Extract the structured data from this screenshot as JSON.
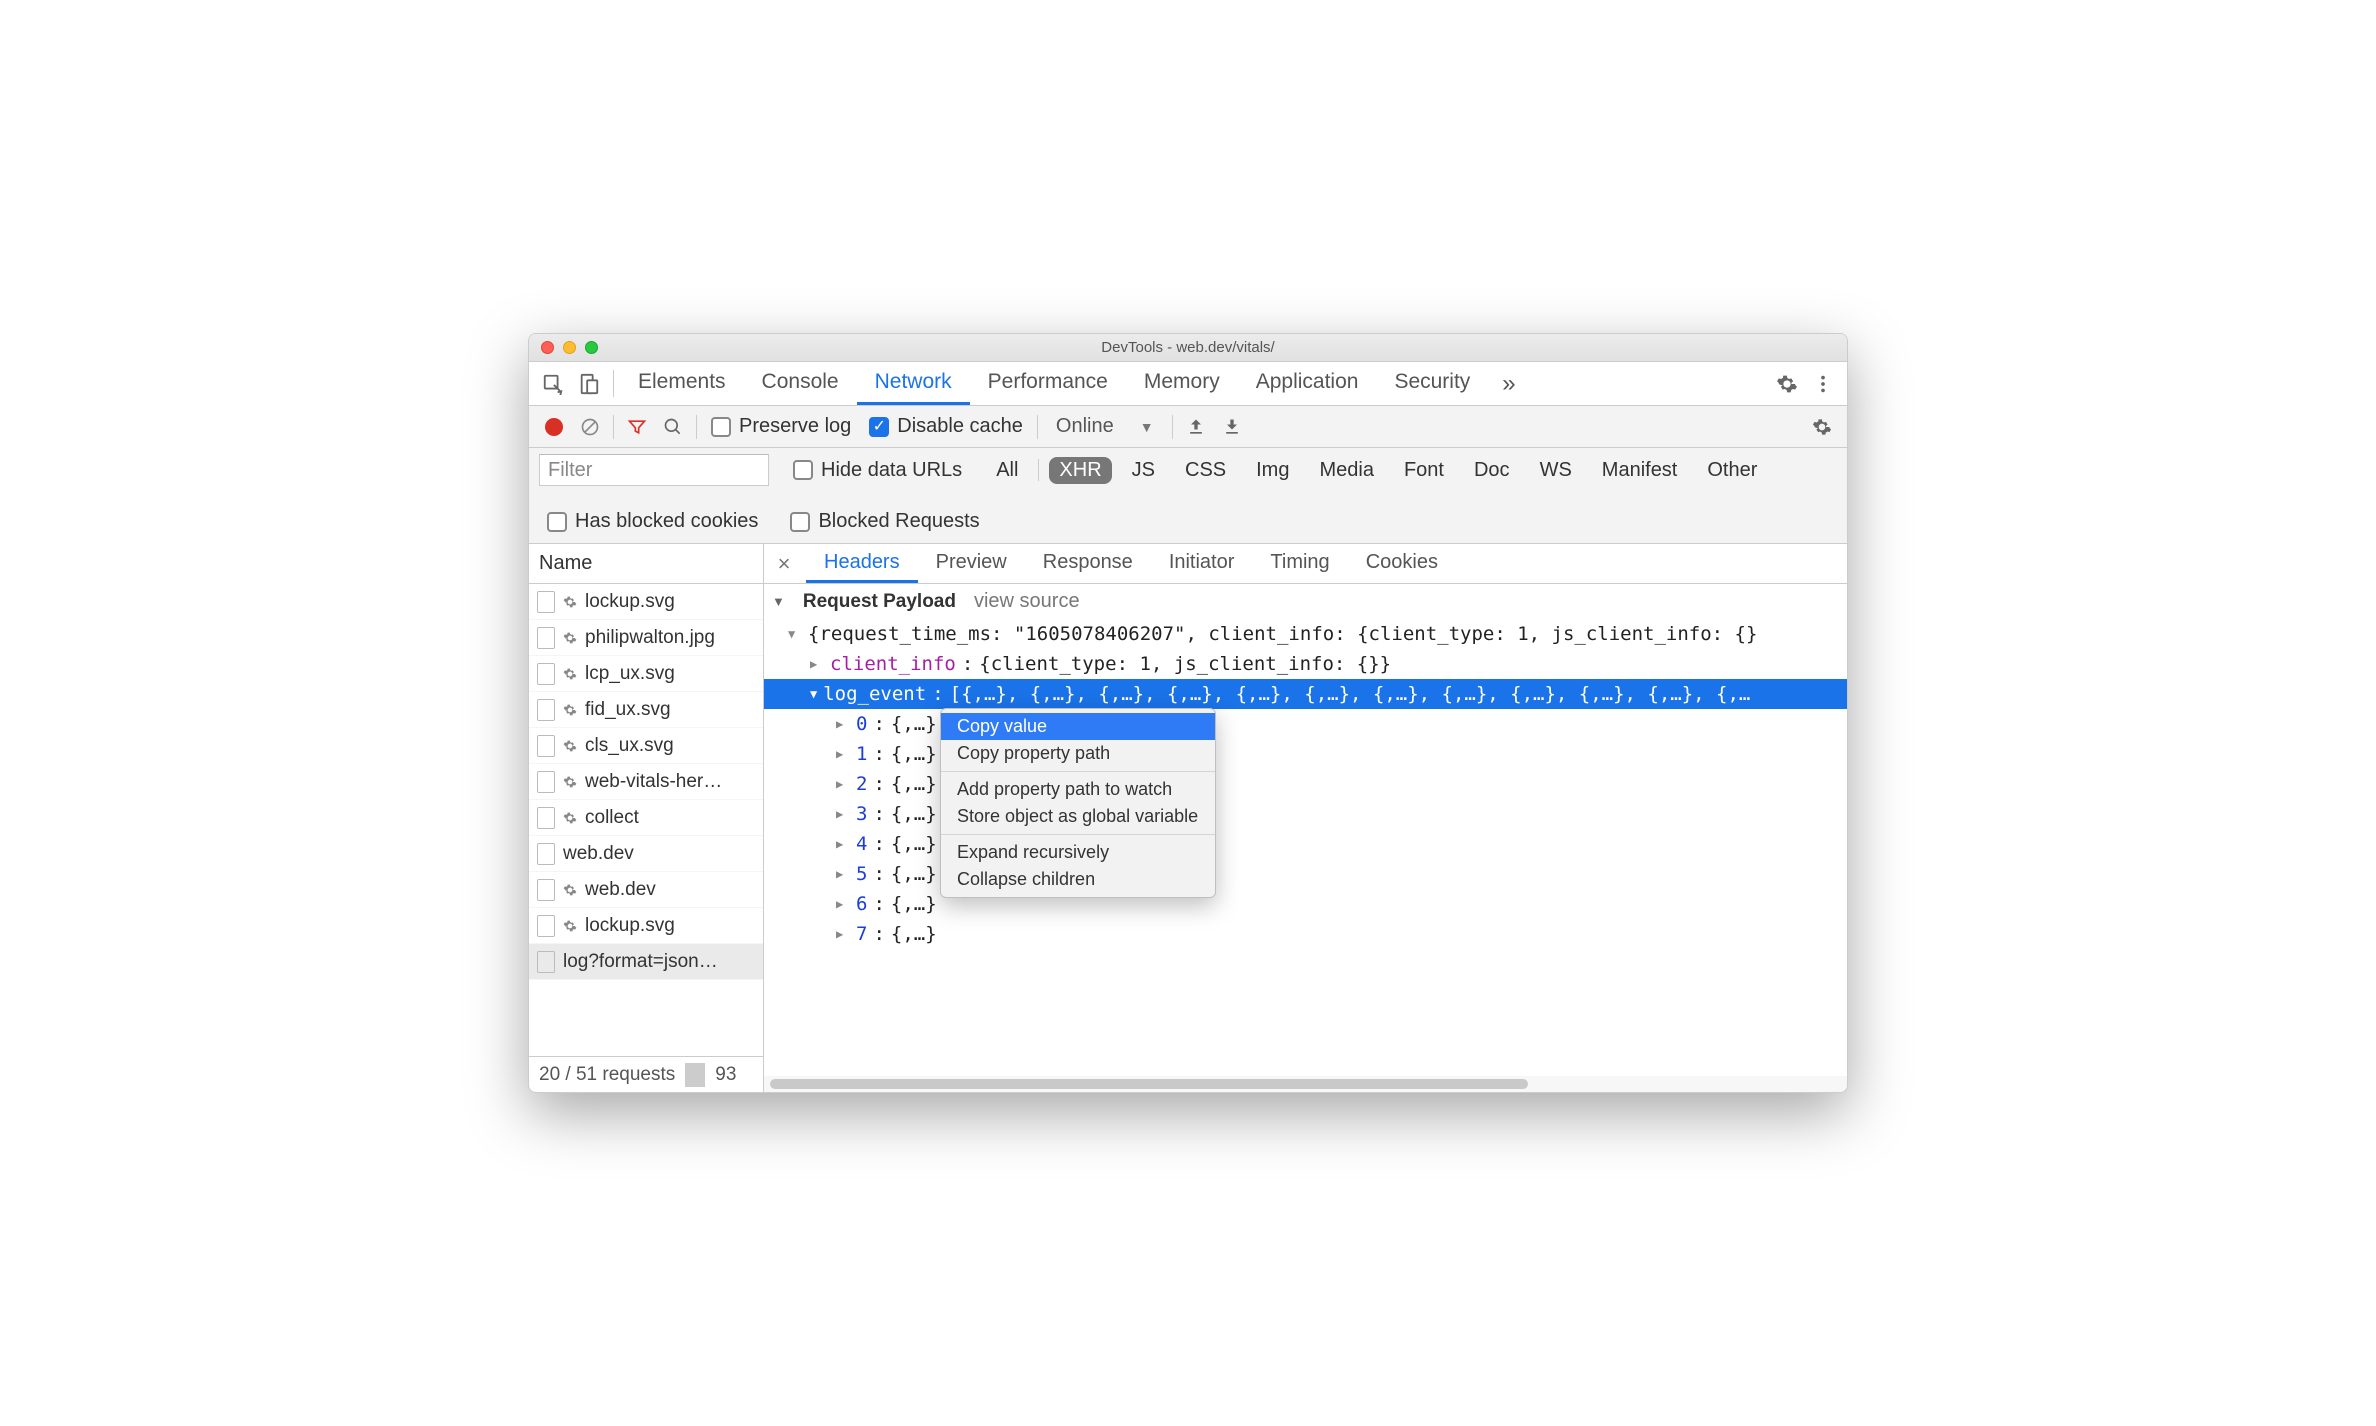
{
  "window_title": "DevTools - web.dev/vitals/",
  "main_tabs": {
    "items": [
      "Elements",
      "Console",
      "Network",
      "Performance",
      "Memory",
      "Application",
      "Security"
    ],
    "active": "Network"
  },
  "net_toolbar": {
    "preserve_log_label": "Preserve log",
    "disable_cache_label": "Disable cache",
    "throttling_label": "Online"
  },
  "filter_row": {
    "filter_placeholder": "Filter",
    "hide_data_urls_label": "Hide data URLs",
    "types": [
      "All",
      "XHR",
      "JS",
      "CSS",
      "Img",
      "Media",
      "Font",
      "Doc",
      "WS",
      "Manifest",
      "Other"
    ],
    "type_active": "XHR",
    "has_blocked_cookies_label": "Has blocked cookies",
    "blocked_requests_label": "Blocked Requests"
  },
  "left_pane": {
    "header": "Name",
    "requests": [
      {
        "name": "lockup.svg",
        "gear": true
      },
      {
        "name": "philipwalton.jpg",
        "gear": true
      },
      {
        "name": "lcp_ux.svg",
        "gear": true
      },
      {
        "name": "fid_ux.svg",
        "gear": true
      },
      {
        "name": "cls_ux.svg",
        "gear": true
      },
      {
        "name": "web-vitals-her…",
        "gear": true
      },
      {
        "name": "collect",
        "gear": true
      },
      {
        "name": "web.dev",
        "gear": false
      },
      {
        "name": "web.dev",
        "gear": true
      },
      {
        "name": "lockup.svg",
        "gear": true
      },
      {
        "name": "log?format=json…",
        "gear": false,
        "selected": true
      }
    ],
    "footer_left": "20 / 51 requests",
    "footer_right": "93"
  },
  "detail_tabs": {
    "items": [
      "Headers",
      "Preview",
      "Response",
      "Initiator",
      "Timing",
      "Cookies"
    ],
    "active": "Headers"
  },
  "payload": {
    "section_title": "Request Payload",
    "view_source_label": "view source",
    "root_line": "{request_time_ms: \"1605078406207\", client_info: {client_type: 1, js_client_info: {}",
    "client_info_key": "client_info",
    "client_info_value": "{client_type: 1, js_client_info: {}}",
    "log_event_key": "log_event",
    "log_event_value": "[{,…}, {,…}, {,…}, {,…}, {,…}, {,…}, {,…}, {,…}, {,…}, {,…}, {,…}, {,…",
    "children": [
      {
        "idx": "0",
        "val": "{,…}"
      },
      {
        "idx": "1",
        "val": "{,…}"
      },
      {
        "idx": "2",
        "val": "{,…}"
      },
      {
        "idx": "3",
        "val": "{,…}"
      },
      {
        "idx": "4",
        "val": "{,…}"
      },
      {
        "idx": "5",
        "val": "{,…}"
      },
      {
        "idx": "6",
        "val": "{,…}"
      },
      {
        "idx": "7",
        "val": "{,…}"
      }
    ]
  },
  "context_menu": {
    "copy_value": "Copy value",
    "copy_property_path": "Copy property path",
    "add_property_path": "Add property path to watch",
    "store_global": "Store object as global variable",
    "expand_recursively": "Expand recursively",
    "collapse_children": "Collapse children"
  }
}
